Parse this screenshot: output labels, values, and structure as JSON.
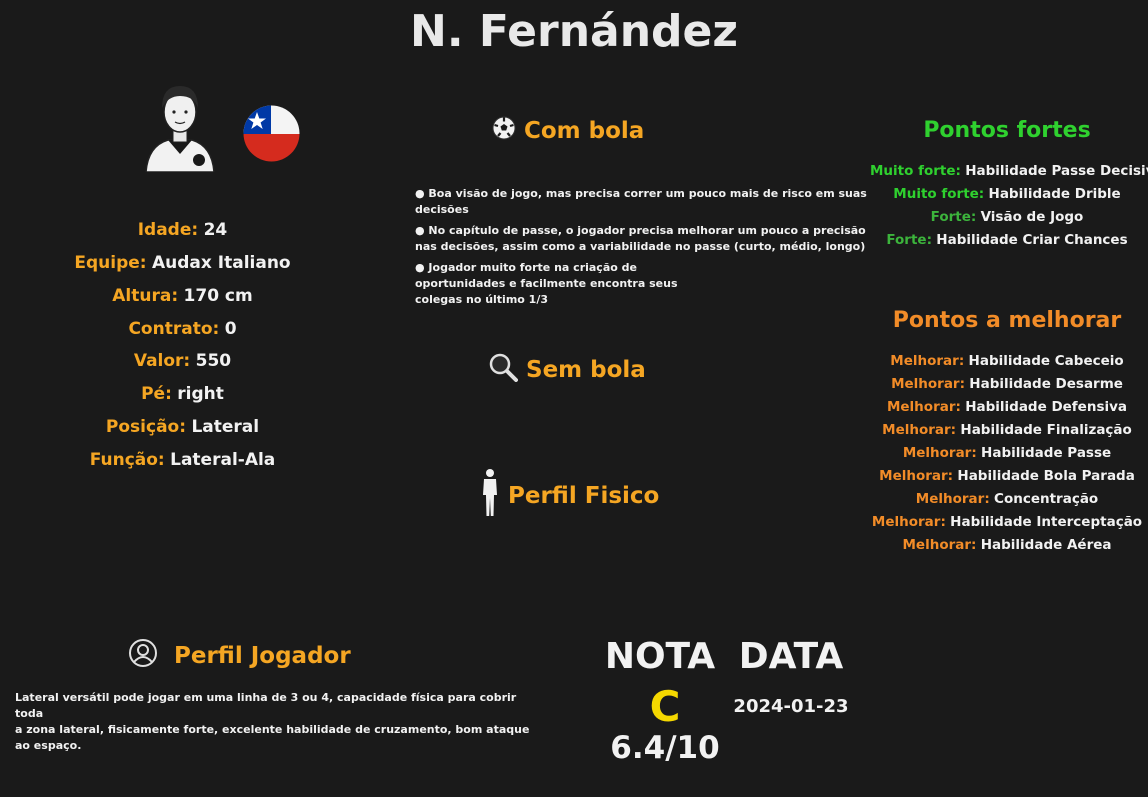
{
  "player": {
    "name": "N. Fernández",
    "info": [
      {
        "label": "Idade:",
        "value": "24"
      },
      {
        "label": "Equipe:",
        "value": "Audax Italiano"
      },
      {
        "label": "Altura:",
        "value": "170 cm"
      },
      {
        "label": "Contrato:",
        "value": "0"
      },
      {
        "label": "Valor:",
        "value": "550"
      },
      {
        "label": "Pé:",
        "value": "right"
      },
      {
        "label": "Posição:",
        "value": "Lateral"
      },
      {
        "label": "Função:",
        "value": "Lateral-Ala"
      }
    ]
  },
  "icons": {
    "avatar": "player-avatar-icon",
    "flag": "chile-flag-icon",
    "com_bola": "soccer-ball-icon",
    "sem_bola": "magnifier-icon",
    "perfil_fisico": "human-body-icon",
    "perfil_jogador": "user-circle-icon"
  },
  "com_bola": {
    "title": "Com bola",
    "bullets": [
      "● Boa visão de jogo, mas precisa correr um pouco mais de risco em suas decisões",
      "● No capítulo de passe, o jogador precisa melhorar um pouco a precisão nas decisões, assim como a variabilidade no passe (curto, médio, longo)",
      "● Jogador muito forte na criação de oportunidades e facilmente encontra seus colegas no último 1/3"
    ]
  },
  "sem_bola": {
    "title": "Sem bola"
  },
  "perfil_fisico": {
    "title": "Perfil Fisico"
  },
  "perfil_jogador": {
    "title": "Perfil Jogador",
    "text_line1": "Lateral versátil pode jogar em uma linha de 3 ou 4, capacidade física para cobrir toda",
    "text_line2": "a zona lateral, fisicamente forte, excelente habilidade de cruzamento, bom ataque ao espaço."
  },
  "pontos_fortes": {
    "title": "Pontos fortes",
    "items": [
      {
        "level": "Muito forte:",
        "skill": "Habilidade Passe Decisivo"
      },
      {
        "level": "Muito forte:",
        "skill": "Habilidade Drible"
      },
      {
        "level": "Forte:",
        "skill": "Visão de Jogo"
      },
      {
        "level": "Forte:",
        "skill": "Habilidade Criar Chances"
      }
    ]
  },
  "pontos_melhorar": {
    "title": "Pontos a melhorar",
    "items": [
      {
        "level": "Melhorar:",
        "skill": "Habilidade Cabeceio"
      },
      {
        "level": "Melhorar:",
        "skill": "Habilidade Desarme"
      },
      {
        "level": "Melhorar:",
        "skill": "Habilidade Defensiva"
      },
      {
        "level": "Melhorar:",
        "skill": "Habilidade Finalização"
      },
      {
        "level": "Melhorar:",
        "skill": "Habilidade Passe"
      },
      {
        "level": "Melhorar:",
        "skill": "Habilidade Bola Parada"
      },
      {
        "level": "Melhorar:",
        "skill": "Concentração"
      },
      {
        "level": "Melhorar:",
        "skill": "Habilidade Interceptação"
      },
      {
        "level": "Melhorar:",
        "skill": "Habilidade Aérea"
      }
    ]
  },
  "grade": {
    "nota_label": "NOTA",
    "data_label": "DATA",
    "letter": "C",
    "score": "6.4/10",
    "date": "2024-01-23"
  },
  "colors": {
    "background": "#1a1a1a",
    "accent_orange": "#f5a623",
    "improve_orange": "#f28c28",
    "strong_green": "#2fd12f",
    "strong_green_dark": "#3cb43c",
    "grade_yellow": "#f5d800"
  }
}
